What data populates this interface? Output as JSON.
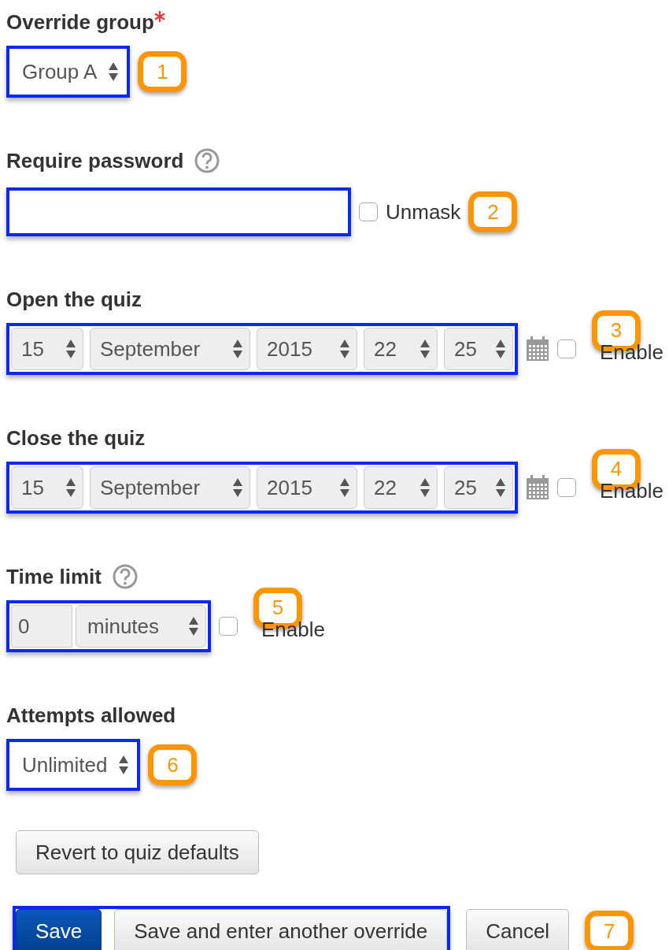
{
  "fields": [
    {
      "kind": "select",
      "label": "Override group",
      "required": true,
      "value": "Group A",
      "callout": "1"
    },
    {
      "kind": "password",
      "label": "Require password",
      "help": true,
      "unmask": {
        "label": "Unmask",
        "checked": false
      },
      "callout": "2"
    },
    {
      "kind": "datetime",
      "label": "Open the quiz",
      "parts": [
        "15",
        "September",
        "2015",
        "22",
        "25"
      ],
      "enable": {
        "label": "Enable",
        "checked": false
      },
      "callout": "3"
    },
    {
      "kind": "datetime",
      "label": "Close the quiz",
      "parts": [
        "15",
        "September",
        "2015",
        "22",
        "25"
      ],
      "enable": {
        "label": "Enable",
        "checked": false
      },
      "callout": "4"
    },
    {
      "kind": "duration",
      "label": "Time limit",
      "help": true,
      "value": "0",
      "unit": "minutes",
      "enable": {
        "label": "Enable",
        "checked": false
      },
      "callout": "5"
    },
    {
      "kind": "select",
      "label": "Attempts allowed",
      "value": "Unlimited",
      "callout": "6"
    }
  ],
  "revert_button": "Revert to quiz defaults",
  "actions": [
    {
      "label": "Save",
      "primary": true
    },
    {
      "label": "Save and enter another override",
      "primary": false
    }
  ],
  "cancel_button": "Cancel",
  "actions_callout": "7"
}
